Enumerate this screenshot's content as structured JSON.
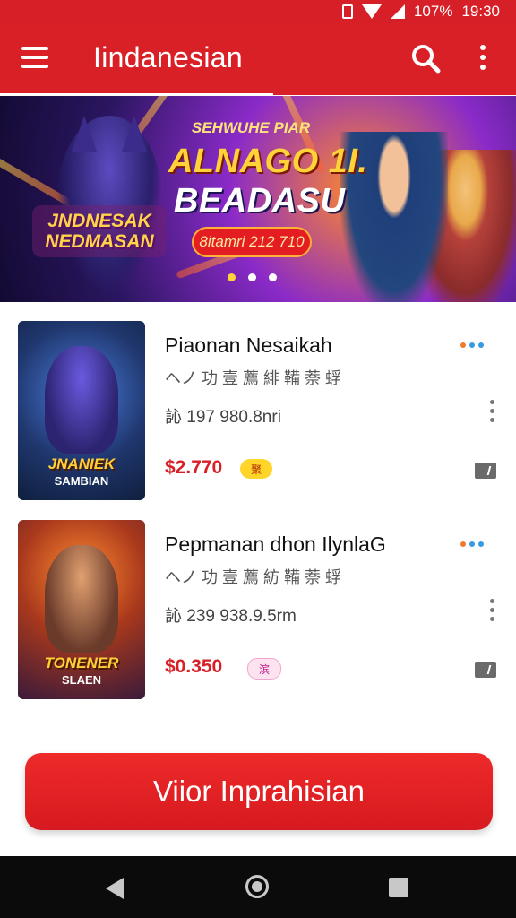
{
  "status_bar": {
    "battery": "107%",
    "time": "19:30"
  },
  "app_bar": {
    "title": "Iindanesian"
  },
  "banner": {
    "kicker": "SEHWUHE PIAR",
    "title_line1": "ALNAGO 1I.",
    "title_line2": "BEADASU",
    "pill": "8itamri 212 710",
    "logo_line1": "JNDNESAK",
    "logo_line2": "NEDMASAN",
    "active_slide": 1,
    "slide_count": 3
  },
  "items": [
    {
      "title": "Piaonan Nesaikah",
      "subtitle": "ヘノ 功 壹 薦 緋 鞴 萘 蜉",
      "meta": "訫 197 980.8nri",
      "price": "$2.770",
      "badge": "聚",
      "thumb_label": "JNANIEK",
      "thumb_sub": "SAMBIAN",
      "dots": [
        "#f07a2a",
        "#3a9ae0",
        "#3a9ae0"
      ]
    },
    {
      "title": "Pepmanan dhon IlynlaG",
      "subtitle": "ヘノ 功 壹 薦 紡 鞴 萘 蜉",
      "meta": "訫 239 938.9.5rm",
      "price": "$0.350",
      "badge": "滨",
      "thumb_label": "TONENER",
      "thumb_sub": "SLAEN",
      "dots": [
        "#f07a2a",
        "#3a9ae0",
        "#3a9ae0"
      ]
    }
  ],
  "cta": {
    "label": "Viior Inprahisian"
  },
  "colors": {
    "primary": "#d92027",
    "price": "#d81f26"
  }
}
